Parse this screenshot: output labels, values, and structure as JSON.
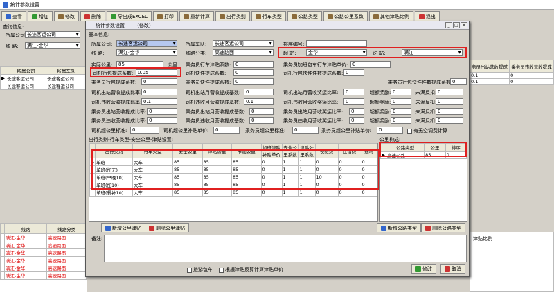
{
  "window": {
    "title": "统计参数设置"
  },
  "toolbar": [
    "查看",
    "增加",
    "修改",
    "删除",
    "导出成EXCEL",
    "打印",
    "重新计算",
    "出行类别",
    "行车类型",
    "公路类型",
    "公路公里系数",
    "其他津贴比例",
    "退出"
  ],
  "query": {
    "title": "查询信息:",
    "company_label": "所属公司:",
    "company_value": "长途客运公司",
    "team_label": "所属车队:",
    "team_value": "",
    "line_label": "线    路:",
    "line_value": "满江-金华",
    "type_label": "线路类型:",
    "type_value": ""
  },
  "bg_table": {
    "headers": [
      "所属公司",
      "所属车队"
    ],
    "rows": [
      [
        "长途客运公司",
        "长途客运公司"
      ],
      [
        "长途客运公司",
        "长途客运公司"
      ]
    ]
  },
  "bg_right": {
    "h1": "务员出站营收提成",
    "h2": "乘务员违收营收提成",
    "r1": [
      "0.1",
      "0"
    ],
    "r2": [
      "0.1",
      "0"
    ],
    "extra": "津贴"
  },
  "bg_bottom": {
    "headers": [
      "线路",
      "线路分类"
    ],
    "rows": [
      [
        "满江-金华",
        "高速路面"
      ],
      [
        "满江-金华",
        "高速路面"
      ],
      [
        "满江-金华",
        "高速路面"
      ],
      [
        "满江-金华",
        "高速路面"
      ],
      [
        "满江-金华",
        "高速路面"
      ],
      [
        "满江-金华",
        "高速路面"
      ]
    ],
    "right_header": "津贴比例"
  },
  "dialog": {
    "title": "统计参数设置——（修改）",
    "basic_title": "基本信息:",
    "company_label": "所属公司:",
    "company_value": "长途客运公司",
    "team_label": "所属车队:",
    "team_value": "长途客运公司",
    "plate_label": "排序编号:",
    "plate_value": "",
    "line_label": "线    路:",
    "line_value": "满江-金华",
    "linetype_label": "线路分类:",
    "linetype_value": "高速路面",
    "start_label": "起    站:",
    "start_value": "金华",
    "end_label": "讫    站:",
    "end_value": "满江",
    "mileage_label": "实际公里:",
    "mileage_value": "85",
    "mileage_unit": "公里",
    "params": [
      {
        "label": "司机行包提成系数:",
        "value": "0.05"
      },
      {
        "label": "乘务员行车津贴系数:",
        "value": "0"
      },
      {
        "label": "乘务员加班包车行车津贴单价:",
        "value": "0"
      },
      {
        "label": "乘务员行包提成系数:",
        "value": "0"
      },
      {
        "label": "司机快件提成系数:",
        "value": "0"
      },
      {
        "label": "乘务员快件提成系数:",
        "value": "0"
      },
      {
        "label": "司机行包快件件数提成系数:",
        "value": "0"
      },
      {
        "label": "乘务员行包快件件数提成系数:",
        "value": "0"
      },
      {
        "label": "司机出站营收提成比率:",
        "value": "0"
      },
      {
        "label": "司机出站月营收提成基数:",
        "value": "0"
      },
      {
        "label": "司机出站月营收奖惩比率:",
        "value": "0"
      },
      {
        "label": "超额奖励:",
        "value": "0"
      },
      {
        "label": "未满反扣:",
        "value": "0"
      },
      {
        "label": "司机违收营收提成比率:",
        "value": "0.1"
      },
      {
        "label": "司机违收月营收提成基数:",
        "value": "0.1"
      },
      {
        "label": "司机违收月营收奖惩比率:",
        "value": "0"
      },
      {
        "label": "超额奖励:",
        "value": "0"
      },
      {
        "label": "未满反扣:",
        "value": "0"
      },
      {
        "label": "乘务员出站营收提成比率:",
        "value": "0"
      },
      {
        "label": "乘务员出站月营收提成基数:",
        "value": "0"
      },
      {
        "label": "乘务员出站月营收奖惩比率:",
        "value": "0"
      },
      {
        "label": "超额奖励:",
        "value": "0"
      },
      {
        "label": "未满反扣:",
        "value": "0"
      },
      {
        "label": "乘务员违收营收提成比率:",
        "value": "0"
      },
      {
        "label": "乘务员违收月营收提成基数:",
        "value": "0"
      },
      {
        "label": "乘务员违收月营收奖惩比率:",
        "value": "0"
      },
      {
        "label": "超额奖励:",
        "value": "0"
      },
      {
        "label": "未满反扣:",
        "value": "0"
      },
      {
        "label": "司机超公里标准:",
        "value": "0"
      },
      {
        "label": "司机超公里补贴单价:",
        "value": "0"
      },
      {
        "label": "乘务员超公里标准:",
        "value": "0"
      },
      {
        "label": "乘务员超公里补贴单价:",
        "value": "0"
      }
    ],
    "no_empty_label": "有无空调费计算",
    "trip_title": "出行类别-行车类型-安全公里-津贴设置:",
    "trip_headers": [
      "出行类别",
      "行车类型",
      "安全公里",
      "津贴公里",
      "节油公里",
      "加班津贴补贴单价",
      "安全公里系数",
      "津贴公里系数",
      "夜班费",
      "住宿费",
      "途耗"
    ],
    "trip_rows": [
      [
        "单班",
        "大车",
        "85",
        "85",
        "85",
        "0",
        "1",
        "1",
        "0",
        "0",
        "0"
      ],
      [
        "单班(加无)",
        "大车",
        "85",
        "85",
        "85",
        "0",
        "1",
        "1",
        "0",
        "0",
        "0"
      ],
      [
        "单班(早晚10)",
        "大车",
        "85",
        "85",
        "85",
        "0",
        "1",
        "1",
        "10",
        "0",
        "0"
      ],
      [
        "单班(加10)",
        "大车",
        "85",
        "85",
        "85",
        "0",
        "1",
        "1",
        "0",
        "0",
        "0"
      ],
      [
        "单班(餐补10)",
        "大车",
        "85",
        "85",
        "85",
        "0",
        "1",
        "1",
        "0",
        "0",
        "0"
      ]
    ],
    "road_title": "公里构成:",
    "road_headers": [
      "公路类型",
      "公里",
      "排序"
    ],
    "road_rows": [
      [
        "高速公路",
        "85",
        "0"
      ]
    ],
    "btn_add_trip": "新增公里津贴",
    "btn_del_trip": "删除公里津贴",
    "btn_add_road": "新增公路类型",
    "btn_del_road": "删除公路类型",
    "remark_label": "备注:",
    "tour_label": "旅游包车",
    "reverse_label": "根据津贴反算计算津贴单价",
    "btn_ok": "修改",
    "btn_cancel": "取消"
  }
}
